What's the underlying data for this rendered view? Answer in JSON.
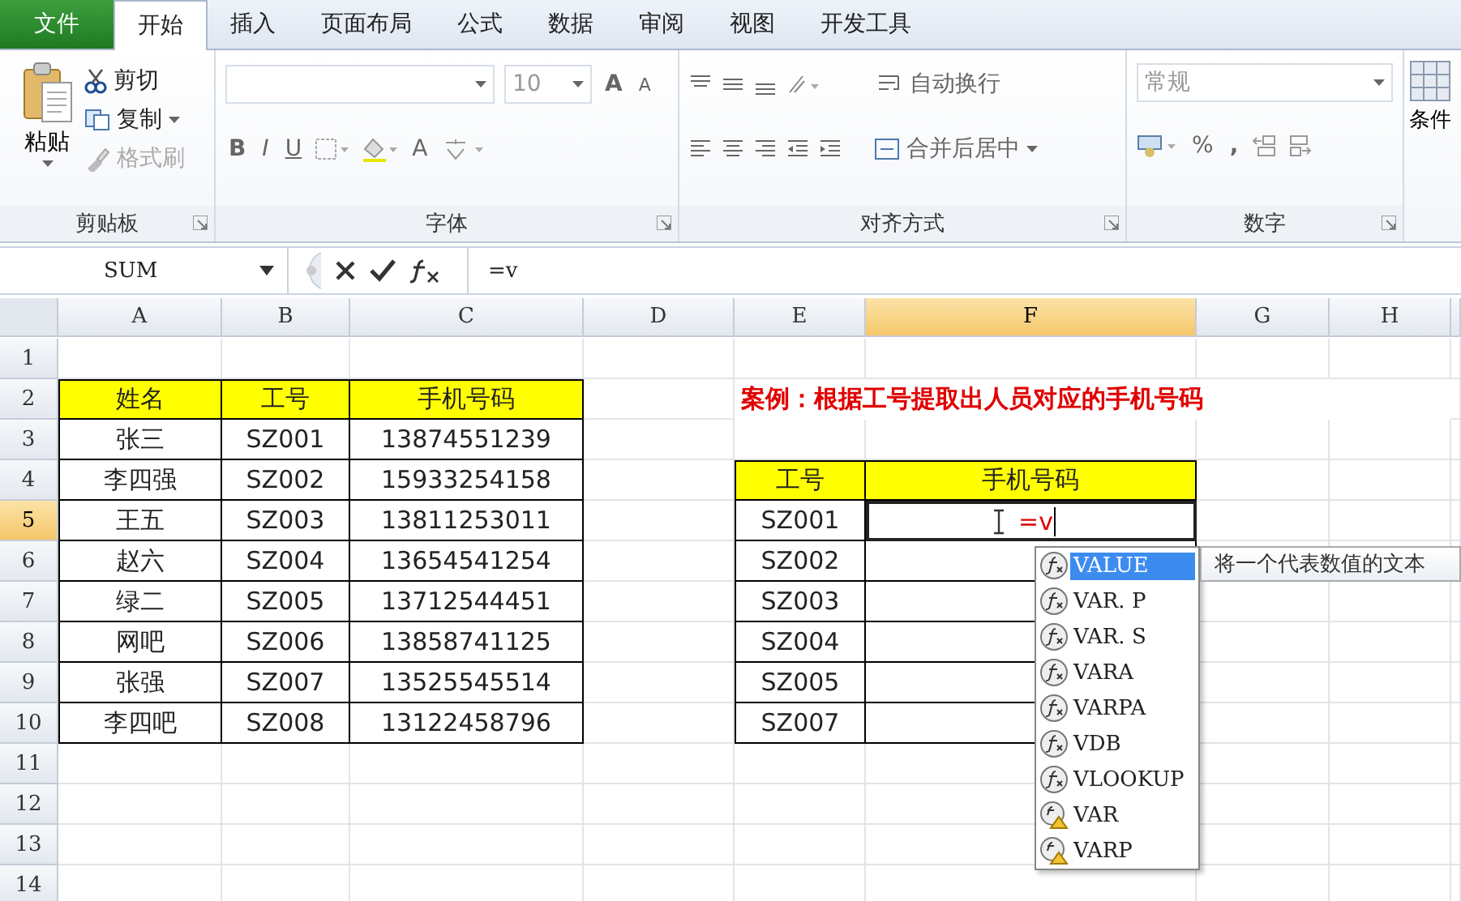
{
  "tabs": [
    {
      "label": "文件",
      "kind": "file",
      "selected": false
    },
    {
      "label": "开始",
      "kind": "tab",
      "selected": true
    },
    {
      "label": "插入",
      "kind": "tab",
      "selected": false
    },
    {
      "label": "页面布局",
      "kind": "tab",
      "selected": false
    },
    {
      "label": "公式",
      "kind": "tab",
      "selected": false
    },
    {
      "label": "数据",
      "kind": "tab",
      "selected": false
    },
    {
      "label": "审阅",
      "kind": "tab",
      "selected": false
    },
    {
      "label": "视图",
      "kind": "tab",
      "selected": false
    },
    {
      "label": "开发工具",
      "kind": "tab",
      "selected": false
    }
  ],
  "ribbon": {
    "clipboard": {
      "label": "剪贴板",
      "paste": "粘贴",
      "cut": "剪切",
      "copy": "复制",
      "format_painter": {
        "label": "格式刷",
        "disabled": true
      }
    },
    "font": {
      "label": "字体",
      "size": "10",
      "grow": "A",
      "shrink": "A",
      "styles": [
        {
          "label": "B",
          "kind": "bold"
        },
        {
          "label": "I",
          "kind": "italic"
        },
        {
          "label": "U",
          "kind": "underline"
        }
      ],
      "font_color": "A"
    },
    "alignment": {
      "label": "对齐方式",
      "wrap": "自动换行",
      "merge": "合并后居中"
    },
    "number": {
      "label": "数字",
      "format": "常规",
      "percent": "%",
      "comma": ","
    },
    "styles": {
      "conditional": "条件"
    }
  },
  "formula_bar": {
    "name_box": "SUM",
    "formula": "=v"
  },
  "columns": [
    {
      "label": "A",
      "selected": false
    },
    {
      "label": "B",
      "selected": false
    },
    {
      "label": "C",
      "selected": false
    },
    {
      "label": "D",
      "selected": false
    },
    {
      "label": "E",
      "selected": false
    },
    {
      "label": "F",
      "selected": true
    },
    {
      "label": "G",
      "selected": false
    },
    {
      "label": "H",
      "selected": false
    }
  ],
  "rows": [
    {
      "label": "1",
      "selected": false
    },
    {
      "label": "2",
      "selected": false
    },
    {
      "label": "3",
      "selected": false
    },
    {
      "label": "4",
      "selected": false
    },
    {
      "label": "5",
      "selected": true
    },
    {
      "label": "6",
      "selected": false
    },
    {
      "label": "7",
      "selected": false
    },
    {
      "label": "8",
      "selected": false
    },
    {
      "label": "9",
      "selected": false
    },
    {
      "label": "10",
      "selected": false
    },
    {
      "label": "11",
      "selected": false
    },
    {
      "label": "12",
      "selected": false
    },
    {
      "label": "13",
      "selected": false
    },
    {
      "label": "14",
      "selected": false
    }
  ],
  "title": "案例：根据工号提取出人员对应的手机号码",
  "source_table": {
    "columns": [
      "姓名",
      "工号",
      "手机号码"
    ],
    "rows": [
      [
        "张三",
        "SZ001",
        "13874551239"
      ],
      [
        "李四强",
        "SZ002",
        "15933254158"
      ],
      [
        "王五",
        "SZ003",
        "13811253011"
      ],
      [
        "赵六",
        "SZ004",
        "13654541254"
      ],
      [
        "绿二",
        "SZ005",
        "13712544451"
      ],
      [
        "网吧",
        "SZ006",
        "13858741125"
      ],
      [
        "张强",
        "SZ007",
        "13525545514"
      ],
      [
        "李四吧",
        "SZ008",
        "13122458796"
      ]
    ]
  },
  "lookup_table": {
    "columns": [
      "工号",
      "手机号码"
    ],
    "rows": [
      {
        "cells": [
          "SZ001",
          "=v"
        ],
        "editing": true
      },
      {
        "cells": [
          "SZ002"
        ],
        "editing": false
      },
      {
        "cells": [
          "SZ003"
        ],
        "editing": false
      },
      {
        "cells": [
          "SZ004"
        ],
        "editing": false
      },
      {
        "cells": [
          "SZ005"
        ],
        "editing": false
      },
      {
        "cells": [
          "SZ007"
        ],
        "editing": false
      }
    ]
  },
  "autocomplete": {
    "items": [
      {
        "label": "VALUE",
        "kind": "function",
        "selected": true
      },
      {
        "label": "VAR. P",
        "kind": "function",
        "selected": false
      },
      {
        "label": "VAR. S",
        "kind": "function",
        "selected": false
      },
      {
        "label": "VARA",
        "kind": "function",
        "selected": false
      },
      {
        "label": "VARPA",
        "kind": "function",
        "selected": false
      },
      {
        "label": "VDB",
        "kind": "function",
        "selected": false
      },
      {
        "label": "VLOOKUP",
        "kind": "function",
        "selected": false
      },
      {
        "label": "VAR",
        "kind": "compat",
        "selected": false
      },
      {
        "label": "VARP",
        "kind": "compat",
        "selected": false
      }
    ],
    "tooltip": "将一个代表数值的文本"
  }
}
